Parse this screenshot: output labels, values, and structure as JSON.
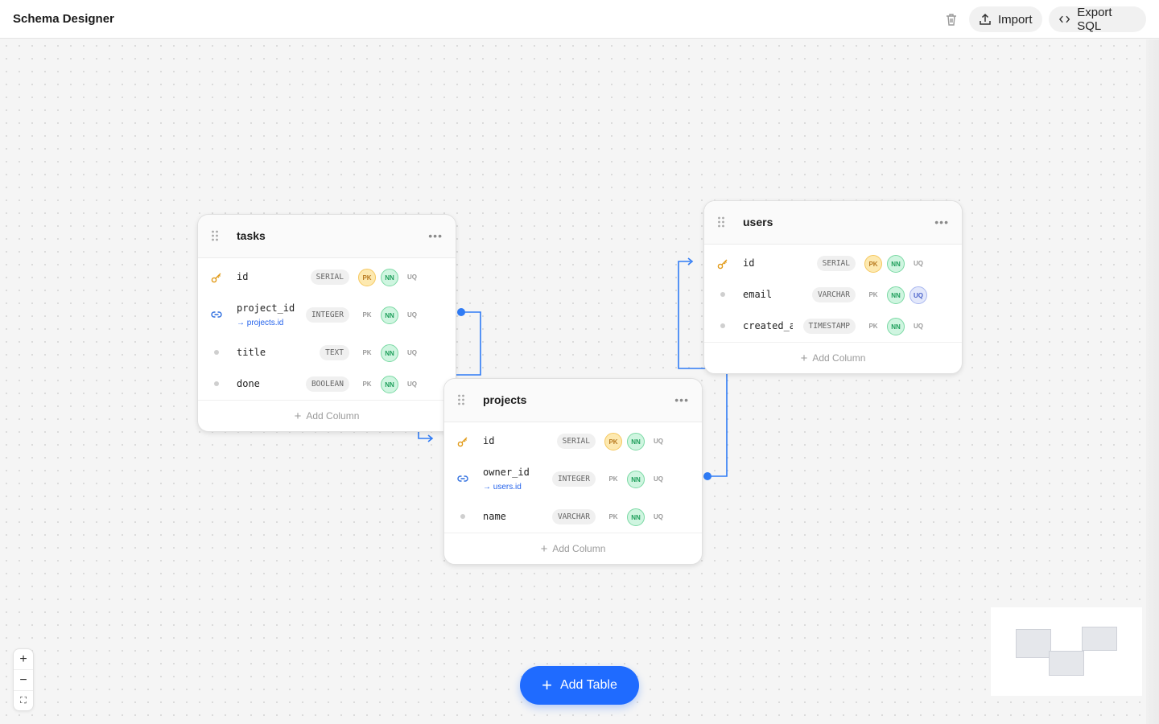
{
  "header": {
    "title": "Schema Designer",
    "import_label": "Import",
    "export_label": "Export SQL"
  },
  "tables": {
    "tasks": {
      "name": "tasks",
      "columns": [
        {
          "name": "id",
          "type": "SERIAL",
          "pk": true,
          "nn": true,
          "uq": false
        },
        {
          "name": "project_id",
          "type": "INTEGER",
          "ref": "→ projects.id",
          "pk": false,
          "nn": true,
          "uq": false
        },
        {
          "name": "title",
          "type": "TEXT",
          "pk": false,
          "nn": true,
          "uq": false
        },
        {
          "name": "done",
          "type": "BOOLEAN",
          "pk": false,
          "nn": true,
          "uq": false
        }
      ]
    },
    "users": {
      "name": "users",
      "columns": [
        {
          "name": "id",
          "type": "SERIAL",
          "pk": true,
          "nn": true,
          "uq": false
        },
        {
          "name": "email",
          "type": "VARCHAR",
          "pk": false,
          "nn": true,
          "uq": true
        },
        {
          "name": "created_a",
          "type": "TIMESTAMP",
          "pk": false,
          "nn": true,
          "uq": false
        }
      ]
    },
    "projects": {
      "name": "projects",
      "columns": [
        {
          "name": "id",
          "type": "SERIAL",
          "pk": true,
          "nn": true,
          "uq": false
        },
        {
          "name": "owner_id",
          "type": "INTEGER",
          "ref": "→ users.id",
          "pk": false,
          "nn": true,
          "uq": false
        },
        {
          "name": "name",
          "type": "VARCHAR",
          "pk": false,
          "nn": true,
          "uq": false
        }
      ]
    }
  },
  "flags": {
    "pk": "PK",
    "nn": "NN",
    "uq": "UQ"
  },
  "add_column_label": "Add Column",
  "add_table_label": "Add Table",
  "icons": {
    "trash": "trash-icon",
    "import": "upload-icon",
    "export": "code-icon",
    "primary_key": "key-icon",
    "foreign_key": "link-icon",
    "grip": "drag-handle-icon",
    "more": "more-icon"
  },
  "colors": {
    "accent": "#1f6bff",
    "link": "#2563eb",
    "pk": "#f6c85f",
    "nn": "#7bd9a4",
    "uq": "#a9b7ef"
  }
}
